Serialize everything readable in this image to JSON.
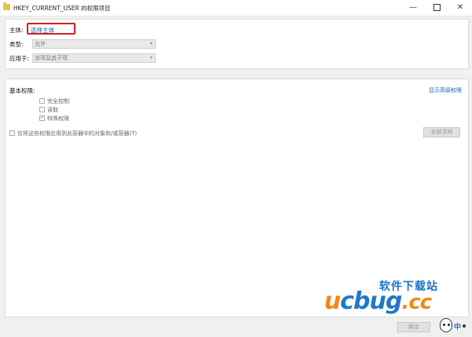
{
  "window": {
    "title": "HKEY_CURRENT_USER 的权限项目",
    "minimize": "—",
    "close": "✕"
  },
  "principal": {
    "label": "主体:",
    "link": "选择主体"
  },
  "type": {
    "label": "类型:",
    "value": "允许"
  },
  "applies_to": {
    "label": "应用于:",
    "value": "该项及其子项"
  },
  "basic_permissions": {
    "title": "基本权限:",
    "show_advanced": "显示高级权限",
    "items": [
      {
        "label": "完全控制",
        "checked": false
      },
      {
        "label": "读取",
        "checked": false
      },
      {
        "label": "特殊权限",
        "checked": true
      }
    ],
    "apply_only": "仅将这些权限应用到此容器中的对象和/或容器(T)",
    "clear_all": "全部清除"
  },
  "footer": {
    "ok": "确定"
  },
  "watermark": {
    "top": "软件下载站",
    "u": "u",
    "main": "cbug",
    "suffix": ".cc"
  },
  "ime": {
    "lang": "中"
  }
}
